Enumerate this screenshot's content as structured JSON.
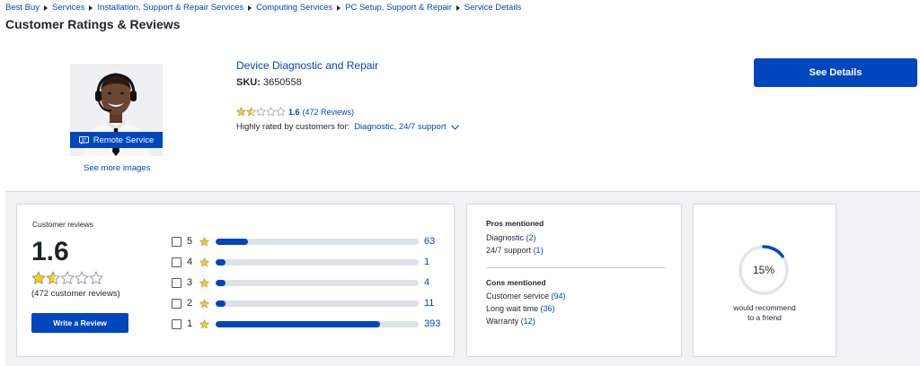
{
  "breadcrumb": [
    "Best Buy",
    "Services",
    "Installation, Support & Repair Services",
    "Computing Services",
    "PC Setup, Support & Repair",
    "Service Details"
  ],
  "page_title": "Customer Ratings & Reviews",
  "product": {
    "image_badge": "Remote Service",
    "see_more_images": "See more images",
    "name": "Device Diagnostic and Repair",
    "sku_label": "SKU:",
    "sku_value": "3650558",
    "rating": "1.6",
    "rating_fraction": 0.32,
    "review_count_text": "(472 Reviews)",
    "highly_rated_label": "Highly rated by customers for:",
    "highly_rated_tags": "Diagnostic, 24/7 support",
    "see_details_label": "See Details"
  },
  "summary": {
    "label": "Customer reviews",
    "average": "1.6",
    "count_text": "(472 customer reviews)",
    "write_review_label": "Write a Review",
    "distribution": [
      {
        "stars": "5",
        "count": "63",
        "fraction": 0.16
      },
      {
        "stars": "4",
        "count": "1",
        "fraction": 0.05
      },
      {
        "stars": "3",
        "count": "4",
        "fraction": 0.05
      },
      {
        "stars": "2",
        "count": "11",
        "fraction": 0.05
      },
      {
        "stars": "1",
        "count": "393",
        "fraction": 0.81
      }
    ]
  },
  "pros": {
    "title": "Pros mentioned",
    "items": [
      {
        "label": "Diagnostic",
        "count": "(2)"
      },
      {
        "label": "24/7 support",
        "count": "(1)"
      }
    ]
  },
  "cons": {
    "title": "Cons mentioned",
    "items": [
      {
        "label": "Customer service",
        "count": "(94)"
      },
      {
        "label": "Long wait time",
        "count": "(36)"
      },
      {
        "label": "Warranty",
        "count": "(12)"
      }
    ]
  },
  "recommend": {
    "percent_text": "15%",
    "fraction": 0.15,
    "line1": "would recommend",
    "line2": "to a friend"
  },
  "colors": {
    "brand_blue": "#0046be",
    "star_yellow": "#ffce00",
    "bar_track": "#dde2e7"
  },
  "icons": [
    "breadcrumb-arrow-icon",
    "remote-service-icon",
    "star-icon",
    "chevron-down-icon",
    "checkbox-icon"
  ]
}
